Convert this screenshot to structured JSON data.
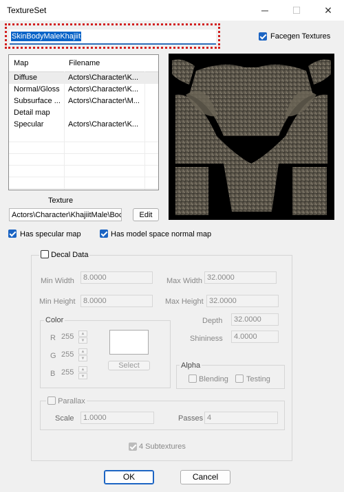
{
  "window": {
    "title": "TextureSet",
    "minimize": "─",
    "maximize": "☐",
    "close": "✕"
  },
  "editor_id": "SkinBodyMaleKhajiit",
  "facegen": {
    "label": "Facegen Textures",
    "checked": true
  },
  "map_list": {
    "columns": [
      "Map",
      "Filename"
    ],
    "rows": [
      {
        "map": "Diffuse",
        "file": "Actors\\Character\\K..."
      },
      {
        "map": "Normal/Gloss",
        "file": "Actors\\Character\\K..."
      },
      {
        "map": "Subsurface ...",
        "file": "Actors\\Character\\M..."
      },
      {
        "map": "Detail map",
        "file": ""
      },
      {
        "map": "Specular",
        "file": "Actors\\Character\\K..."
      }
    ]
  },
  "texture": {
    "label": "Texture",
    "path": "Actors\\Character\\KhajiitMale\\Boc",
    "edit": "Edit"
  },
  "has_specular": {
    "label": "Has specular map",
    "checked": true
  },
  "has_model_space": {
    "label": "Has model space normal map",
    "checked": true
  },
  "decal": {
    "label": "Decal Data",
    "min_width_label": "Min Width",
    "min_width": "8.0000",
    "max_width_label": "Max Width",
    "max_width": "32.0000",
    "min_height_label": "Min Height",
    "min_height": "8.0000",
    "max_height_label": "Max Height",
    "max_height": "32.0000",
    "depth_label": "Depth",
    "depth": "32.0000",
    "shininess_label": "Shininess",
    "shininess": "4.0000",
    "color": {
      "label": "Color",
      "r_label": "R",
      "r": "255",
      "g_label": "G",
      "g": "255",
      "b_label": "B",
      "b": "255",
      "select": "Select"
    },
    "alpha": {
      "label": "Alpha",
      "blending": "Blending",
      "testing": "Testing"
    },
    "parallax": {
      "label": "Parallax",
      "scale_label": "Scale",
      "scale": "1.0000",
      "passes_label": "Passes",
      "passes": "4"
    },
    "subtextures": "4 Subtextures"
  },
  "buttons": {
    "ok": "OK",
    "cancel": "Cancel"
  }
}
